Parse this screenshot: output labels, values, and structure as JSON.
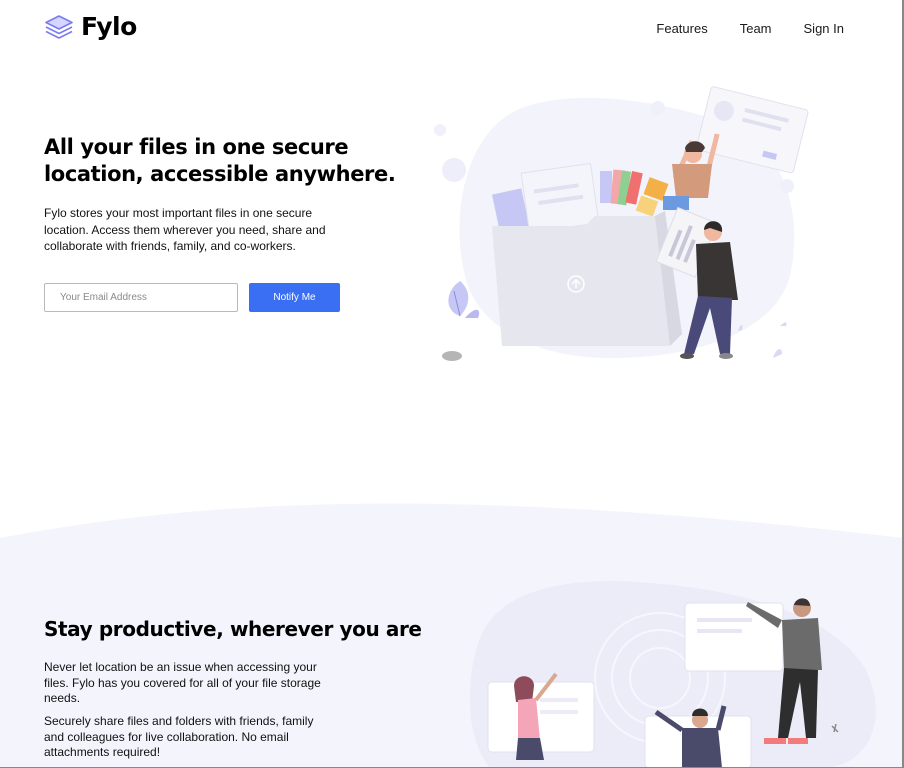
{
  "brand": {
    "name": "Fylo",
    "logo_color": "#6b6bf0"
  },
  "nav": {
    "items": [
      "Features",
      "Team",
      "Sign In"
    ]
  },
  "hero": {
    "title": "All your files in one secure location, accessible anywhere.",
    "description": "Fylo stores your most important files in one secure location. Access them wherever you need, share and collaborate with friends, family, and co-workers.",
    "email_placeholder": "Your Email Address",
    "cta_label": "Notify Me"
  },
  "productive": {
    "title": "Stay productive, wherever you are",
    "paragraphs": [
      "Never let location be an issue when accessing your files. Fylo has you covered for all of your file storage needs.",
      "Securely share files and folders with friends, family and colleagues for live collaboration. No email attachments required!"
    ]
  },
  "colors": {
    "accent": "#3a6ff3",
    "band_bg": "#f4f4fc",
    "blob": "#f2f2fb"
  }
}
